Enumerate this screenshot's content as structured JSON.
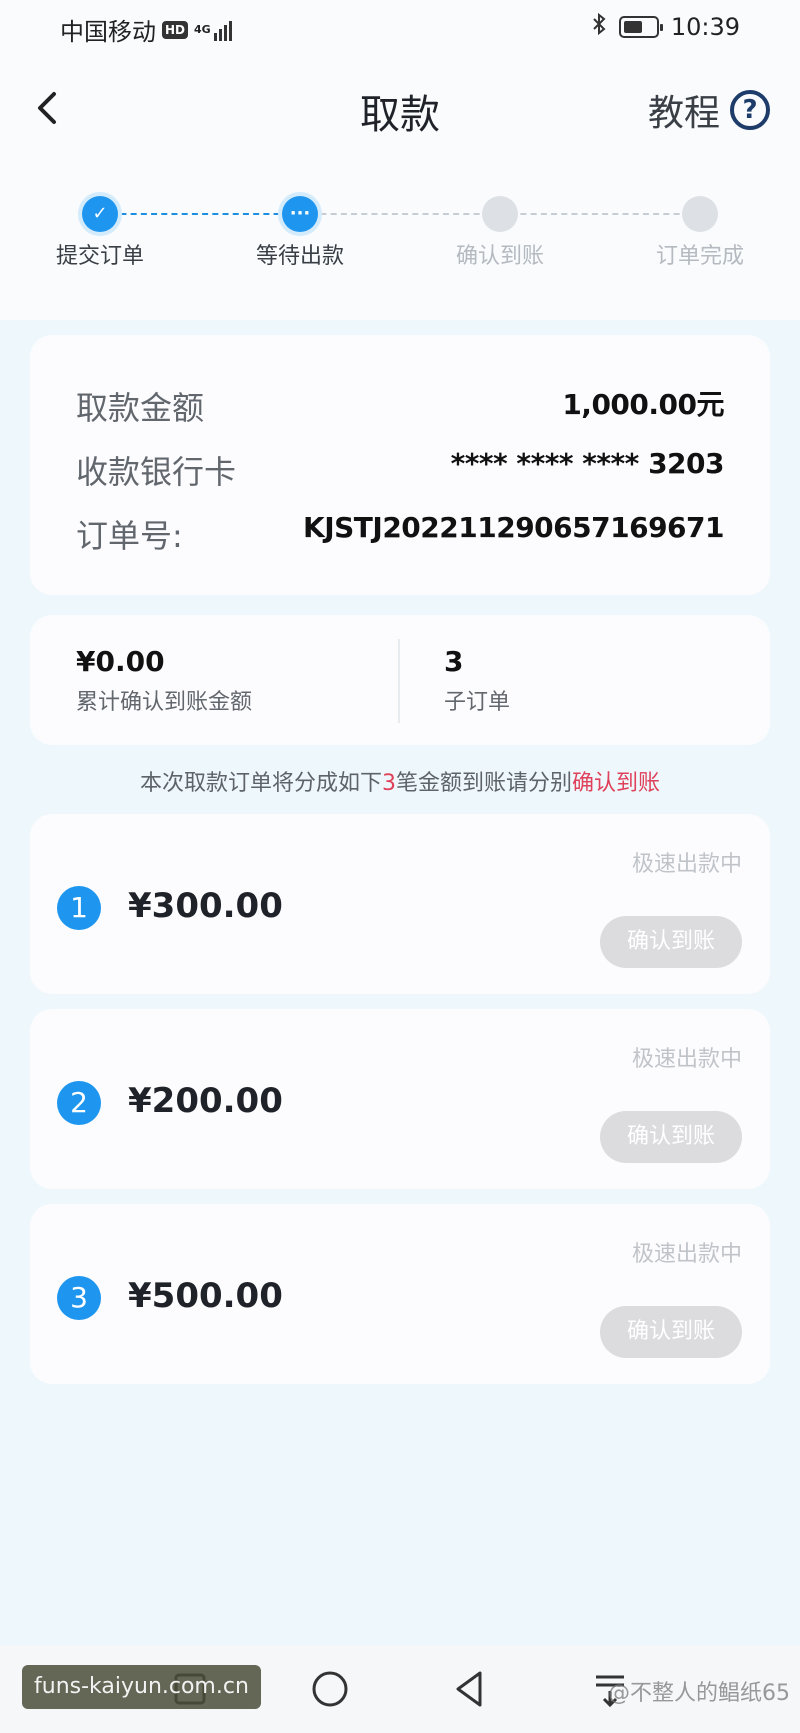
{
  "status_bar": {
    "carrier": "中国移动",
    "hd": "HD",
    "network": "4G",
    "time": "10:39"
  },
  "header": {
    "title": "取款",
    "tutorial_label": "教程",
    "help_glyph": "?"
  },
  "stepper": {
    "steps": [
      {
        "label": "提交订单",
        "state": "done",
        "glyph": "✓"
      },
      {
        "label": "等待出款",
        "state": "current",
        "glyph": "···"
      },
      {
        "label": "确认到账",
        "state": "pending",
        "glyph": ""
      },
      {
        "label": "订单完成",
        "state": "pending",
        "glyph": ""
      }
    ]
  },
  "order_info": {
    "amount_label": "取款金额",
    "amount_value": "1,000.00元",
    "card_label": "收款银行卡",
    "card_value": "**** **** **** 3203",
    "order_label": "订单号:",
    "order_value": "KJSTJ20221129065716967‍1"
  },
  "summary": {
    "confirmed_value": "¥0.00",
    "confirmed_label": "累计确认到账金额",
    "suborders_value": "3",
    "suborders_label": "子订单"
  },
  "notice": {
    "prefix": "本次取款订单将分成如下",
    "count": "3",
    "middle": "笔金额到账请分别",
    "action": "确认到账"
  },
  "sub_orders": [
    {
      "num": "1",
      "amount": "¥300.00",
      "status": "极速出款中",
      "button": "确认到账"
    },
    {
      "num": "2",
      "amount": "¥200.00",
      "status": "极速出款中",
      "button": "确认到账"
    },
    {
      "num": "3",
      "amount": "¥500.00",
      "status": "极速出款中",
      "button": "确认到账"
    }
  ],
  "watermarks": {
    "left": "funs-kaiyun.com.cn",
    "right": "@不整人的鲳纸65"
  },
  "colors": {
    "accent": "#1e96ef",
    "highlight": "#e0415a",
    "page_bg": "#eef8fc"
  }
}
